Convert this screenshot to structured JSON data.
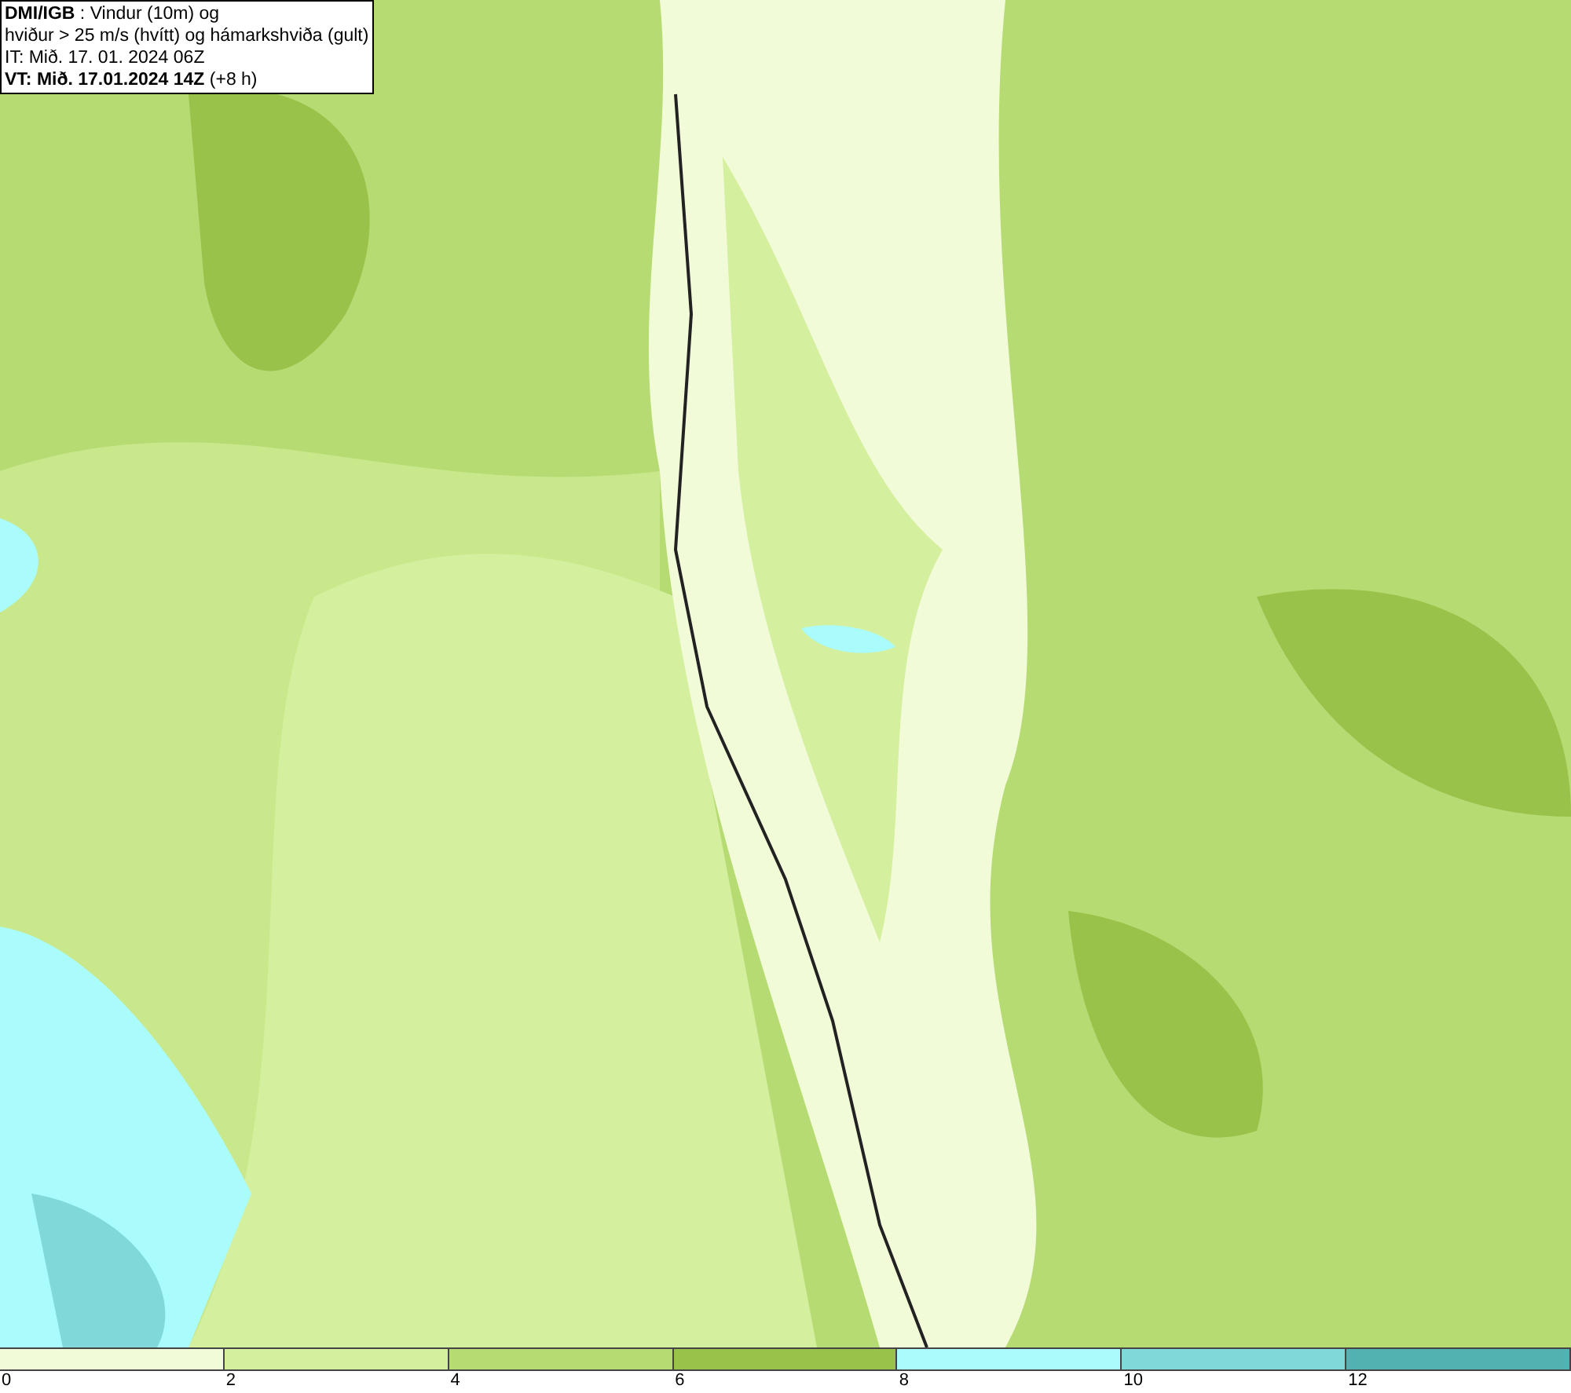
{
  "legend": {
    "lines": [
      "**DMI/IGB** : Vindur (10m) og",
      "hviður > 25 m/s (hvítt) og hámarkshviða (gult)",
      "IT: Mið. 17. 01. 2024 06Z",
      "**VT: Mið. 17.01.2024 14Z** (+8 h)"
    ]
  },
  "colorbar": {
    "segments": [
      {
        "color": "#f2fbd8"
      },
      {
        "color": "#d4ef9e"
      },
      {
        "color": "#b6db73"
      },
      {
        "color": "#99c24a"
      },
      {
        "color": "#aafcfc"
      },
      {
        "color": "#80d8d8"
      },
      {
        "color": "#52b2b2"
      }
    ],
    "ticks": [
      "0",
      "2",
      "4",
      "6",
      "8",
      "10",
      "12"
    ]
  }
}
